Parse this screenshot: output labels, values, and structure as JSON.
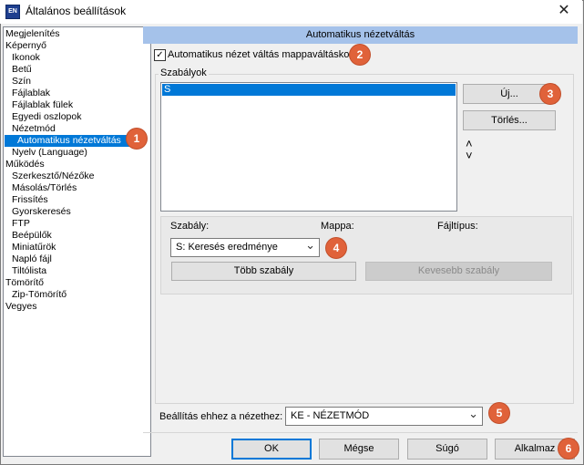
{
  "window": {
    "title": "Általános beállítások",
    "icon_text": "EN",
    "close_glyph": "✕"
  },
  "tree": {
    "items": [
      {
        "label": "Megjelenítés"
      },
      {
        "label": "Képernyő"
      },
      {
        "label": "Ikonok"
      },
      {
        "label": "Betű"
      },
      {
        "label": "Szín"
      },
      {
        "label": "Fájlablak"
      },
      {
        "label": "Fájlablak fülek"
      },
      {
        "label": "Egyedi oszlopok"
      },
      {
        "label": "Nézetmód"
      },
      {
        "label": "Automatikus nézetváltás"
      },
      {
        "label": "Nyelv (Language)"
      },
      {
        "label": "Működés"
      },
      {
        "label": "Szerkesztő/Nézőke"
      },
      {
        "label": "Másolás/Törlés"
      },
      {
        "label": "Frissítés"
      },
      {
        "label": "Gyorskeresés"
      },
      {
        "label": "FTP"
      },
      {
        "label": "Beépülők"
      },
      {
        "label": "Miniatűrök"
      },
      {
        "label": "Napló fájl"
      },
      {
        "label": "Tiltólista"
      },
      {
        "label": "Tömörítő"
      },
      {
        "label": "Zip-Tömörítő"
      },
      {
        "label": "Vegyes"
      }
    ]
  },
  "main": {
    "header": "Automatikus nézetváltás",
    "checkbox_label": "Automatikus nézet váltás mappaváltáskor:",
    "checkbox_mark": "✓",
    "rules_group_label": "Szabályok",
    "rules_list": [
      "S"
    ],
    "new_button": "Új...",
    "delete_button": "Törlés...",
    "up_arrow": "˄",
    "down_arrow": "˅",
    "rule_label": "Szabály:",
    "folder_label": "Mappa:",
    "filetype_label": "Fájltípus:",
    "rule_select_value": "S: Keresés eredménye",
    "more_rules_button": "Több szabály",
    "fewer_rules_button": "Kevesebb szabály",
    "view_setting_label": "Beállítás ehhez a nézethez:",
    "view_setting_value": "KE - NÉZETMÓD",
    "dropdown_glyph": "⌄"
  },
  "footer": {
    "ok": "OK",
    "cancel": "Mégse",
    "help": "Súgó",
    "apply": "Alkalmaz"
  },
  "badges": [
    "1",
    "2",
    "3",
    "4",
    "5",
    "6"
  ],
  "colors": {
    "selection": "#0078d7",
    "header_bg": "#a5c2ea",
    "badge": "#e0623a"
  }
}
